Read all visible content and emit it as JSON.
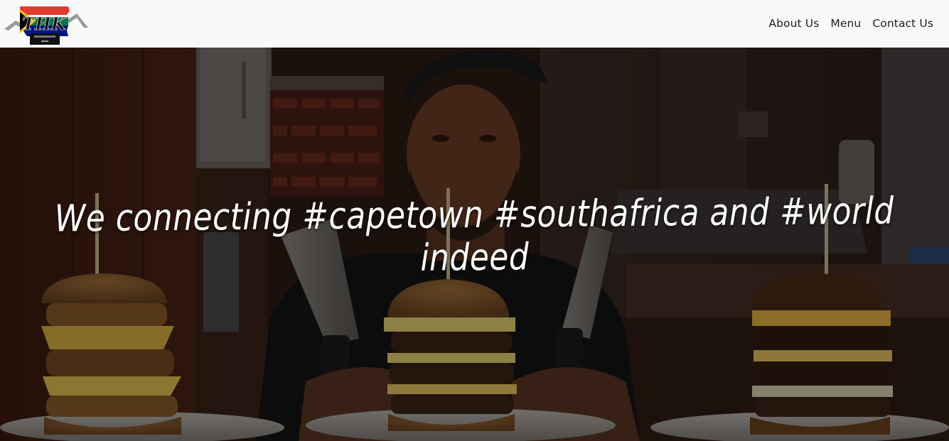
{
  "navbar": {
    "logo_icon": "south-africa-flag-logo",
    "logo_text": "THK",
    "links": [
      {
        "label": "About Us"
      },
      {
        "label": "Menu"
      },
      {
        "label": "Contact Us"
      }
    ]
  },
  "hero": {
    "image": "chef-with-three-burgers-photo",
    "title": "We connecting #capetown #southafrica and #world indeed"
  },
  "colors": {
    "navbar_bg": "#f8f9fa",
    "nav_text": "#1f1f1f",
    "hero_text": "#ffffff",
    "flag_red": "#e03c31",
    "flag_green": "#007749",
    "flag_blue": "#001489",
    "flag_gold": "#ffb81c"
  }
}
